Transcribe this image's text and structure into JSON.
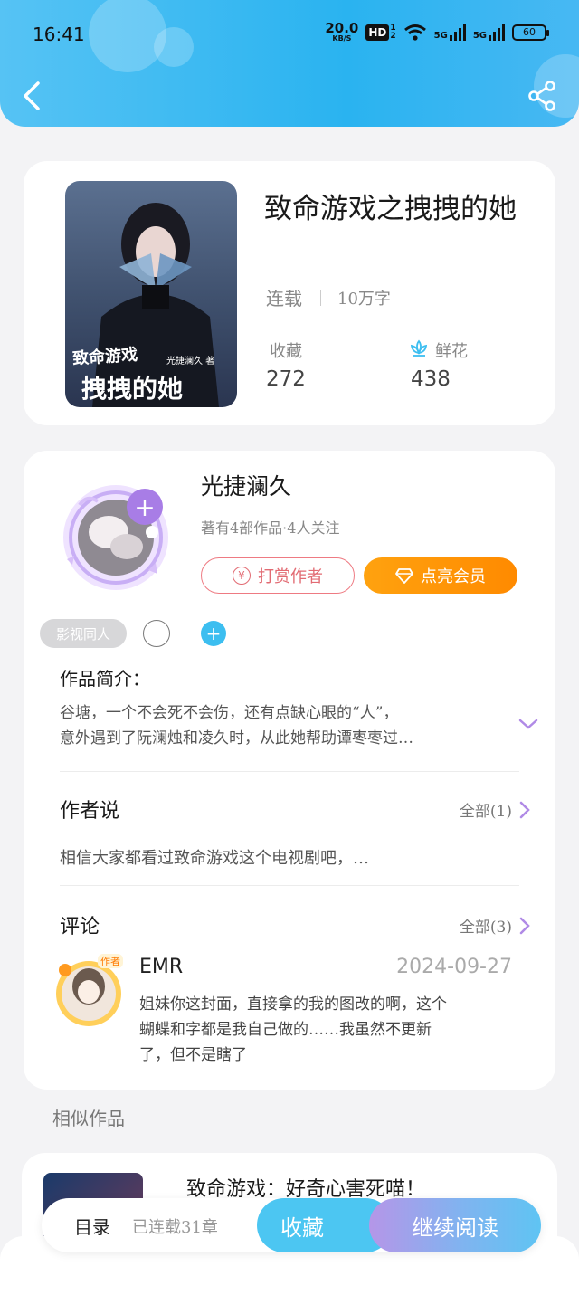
{
  "status_bar": {
    "time": "16:41",
    "net_speed": "20.0",
    "net_unit": "KB/S",
    "hd": "HD",
    "hd_sup": "1",
    "hd_sub": "2",
    "sig1": "5G",
    "sig2": "5G",
    "battery": "60"
  },
  "header": {
    "back_icon": "chevron-left-icon",
    "share_icon": "share-icon",
    "bg_color": "#2ab3f0"
  },
  "book": {
    "title": "致命游戏之拽拽的她",
    "status": "连载",
    "word_count": "10万字",
    "collect_label": "收藏",
    "collect_count": "272",
    "flower_label": "鲜花",
    "flower_count": "438",
    "cover_title": "致命游戏",
    "cover_subtitle": "拽拽的她",
    "cover_author": "光捷澜久 著"
  },
  "author": {
    "name": "光捷澜久",
    "summary": "著有4部作品·4人关注",
    "tip_button": "打赏作者",
    "tip_icon_symbol": "¥",
    "vip_button": "点亮会员",
    "tag": "影视同人"
  },
  "intro": {
    "heading": "作品简介：",
    "line1": "谷塘，一个不会死不会伤，还有点缺心眼的“人”，",
    "line2": "意外遇到了阮澜烛和凌久时，从此她帮助谭枣枣过…"
  },
  "author_says": {
    "heading": "作者说",
    "more": "全部(1)",
    "text": "相信大家都看过致命游戏这个电视剧吧，…"
  },
  "comments": {
    "heading": "评论",
    "more": "全部(3)",
    "user": "EMR",
    "badge": "作者",
    "date": "2024-09-27",
    "line1": "姐妹你这封面，直接拿的我的图改的啊，这个",
    "line2": "蝴蝶和字都是我自己做的……我虽然不更新",
    "line3": "了，但不是瞎了"
  },
  "similar": {
    "heading": "相似作品",
    "title": "致命游戏：好奇心害死喵！"
  },
  "bottom_bar": {
    "toc": "目录",
    "chapters": "已连载31章",
    "collect": "收藏",
    "read": "继续阅读"
  }
}
